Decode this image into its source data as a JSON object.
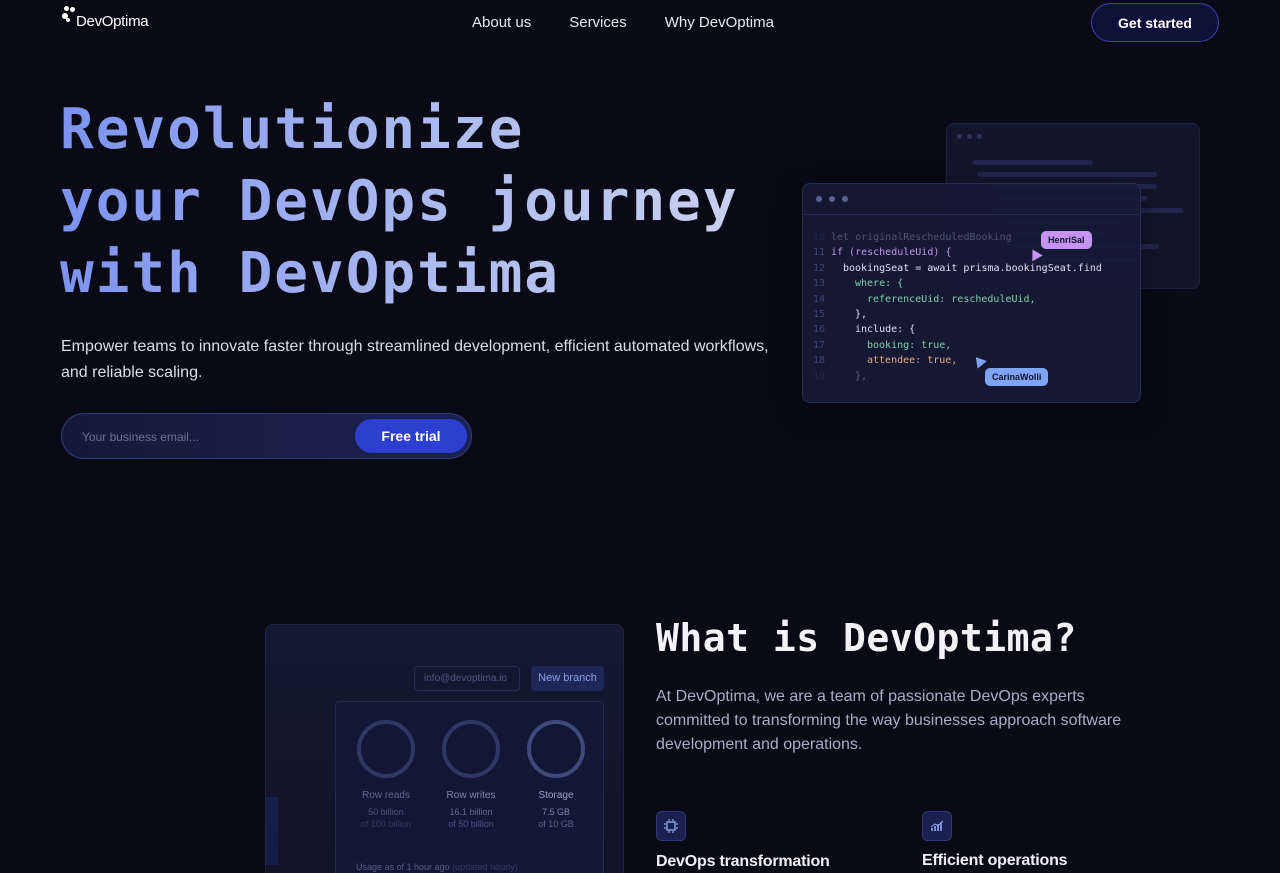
{
  "nav": {
    "brand": "DevOptima",
    "links": [
      "About us",
      "Services",
      "Why DevOptima"
    ],
    "cta": "Get started"
  },
  "hero": {
    "title_lines": [
      "Revolutionize",
      "your DevOps journey",
      "with DevOptima"
    ],
    "subtitle": "Empower teams to innovate faster through streamlined development, efficient automated workflows, and reliable scaling.",
    "email_placeholder": "Your business email...",
    "trial_button": "Free trial"
  },
  "code_window": {
    "lines": [
      {
        "n": "10",
        "text": "let originalRescheduledBooking"
      },
      {
        "n": "11",
        "text": "if (rescheduleUid) {"
      },
      {
        "n": "12",
        "text": "bookingSeat = await prisma.bookingSeat.find"
      },
      {
        "n": "13",
        "text": "where: {"
      },
      {
        "n": "14",
        "text": "referenceUid: rescheduleUid,"
      },
      {
        "n": "15",
        "text": "},"
      },
      {
        "n": "16",
        "text": "include: {"
      },
      {
        "n": "17",
        "text": "booking: true,"
      },
      {
        "n": "18",
        "text": "attendee: true,"
      },
      {
        "n": "19",
        "text": "},"
      }
    ],
    "cursors": [
      {
        "name": "HenriSal",
        "color": "#c694f0"
      },
      {
        "name": "CarinaWolli",
        "color": "#7fa3f5"
      }
    ]
  },
  "dashboard": {
    "email": "info@devoptima.io",
    "new_branch": "New branch",
    "metrics": [
      {
        "label": "Row reads",
        "value": "50 billion",
        "max": "of 100 billion"
      },
      {
        "label": "Row writes",
        "value": "16.1 billion",
        "max": "of 50 billion"
      },
      {
        "label": "Storage",
        "value": "7.5 GB",
        "max": "of 10 GB"
      }
    ],
    "usage": "Usage as of 1 hour ago",
    "usage_note": "(updated hourly)"
  },
  "about": {
    "title": "What is DevOptima?",
    "text": "At DevOptima, we are a team of passionate DevOps experts committed to transforming the way businesses approach software development and operations.",
    "features": [
      {
        "title": "DevOps transformation",
        "icon": "chip-icon"
      },
      {
        "title": "Efficient operations",
        "icon": "chart-icon"
      }
    ]
  },
  "colors": {
    "background": "#0a0a17",
    "accent": "#2b3fd1",
    "title_gradient_start": "#7b93f0"
  }
}
